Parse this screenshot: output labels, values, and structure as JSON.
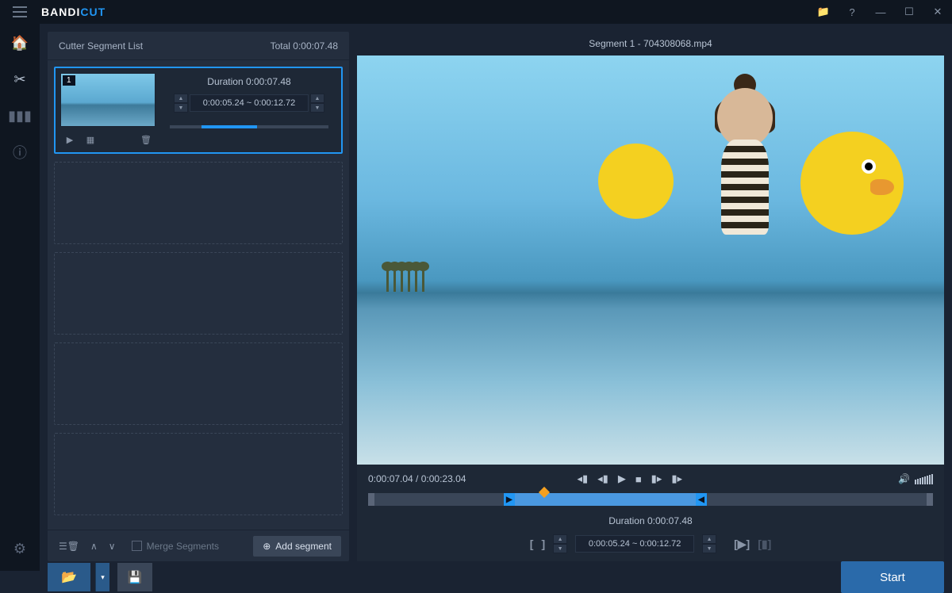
{
  "app": {
    "brand1": "BANDI",
    "brand2": "CUT"
  },
  "titlebar": {
    "folder": "📁",
    "help": "?",
    "min": "—",
    "max": "☐",
    "close": "✕"
  },
  "panel": {
    "title": "Cutter Segment List",
    "total_label": "Total",
    "total_time": "0:00:07.48"
  },
  "segment": {
    "index": "1",
    "duration_label": "Duration",
    "duration_time": "0:00:07.48",
    "time_range": "0:00:05.24 ~ 0:00:12.72"
  },
  "footer": {
    "merge_label": "Merge Segments",
    "add_label": "Add segment"
  },
  "preview": {
    "title": "Segment 1 - 704308068.mp4",
    "current": "0:00:07.04",
    "total": "0:00:23.04",
    "duration_label": "Duration",
    "duration_time": "0:00:07.48",
    "time_range": "0:00:05.24 ~ 0:00:12.72"
  },
  "action": {
    "start": "Start"
  }
}
